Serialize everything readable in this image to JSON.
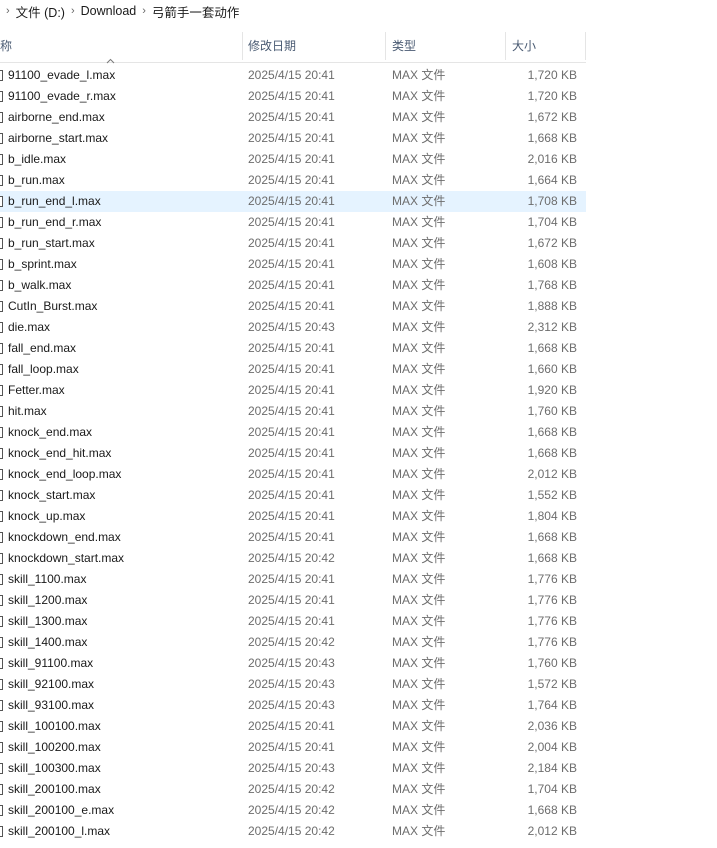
{
  "breadcrumb": {
    "items": [
      "文件 (D:)",
      "Download",
      "弓箭手一套动作"
    ],
    "separator": "›"
  },
  "columns": {
    "name": "称",
    "date": "修改日期",
    "type": "类型",
    "size": "大小"
  },
  "icons": {
    "sort": "sort-up-icon",
    "file": "file-icon",
    "separator": "chevron-right-icon"
  },
  "files": [
    {
      "name": "91100_evade_l.max",
      "date": "2025/4/15 20:41",
      "type": "MAX 文件",
      "size": "1,720 KB"
    },
    {
      "name": "91100_evade_r.max",
      "date": "2025/4/15 20:41",
      "type": "MAX 文件",
      "size": "1,720 KB"
    },
    {
      "name": "airborne_end.max",
      "date": "2025/4/15 20:41",
      "type": "MAX 文件",
      "size": "1,672 KB"
    },
    {
      "name": "airborne_start.max",
      "date": "2025/4/15 20:41",
      "type": "MAX 文件",
      "size": "1,668 KB"
    },
    {
      "name": "b_idle.max",
      "date": "2025/4/15 20:41",
      "type": "MAX 文件",
      "size": "2,016 KB"
    },
    {
      "name": "b_run.max",
      "date": "2025/4/15 20:41",
      "type": "MAX 文件",
      "size": "1,664 KB"
    },
    {
      "name": "b_run_end_l.max",
      "date": "2025/4/15 20:41",
      "type": "MAX 文件",
      "size": "1,708 KB"
    },
    {
      "name": "b_run_end_r.max",
      "date": "2025/4/15 20:41",
      "type": "MAX 文件",
      "size": "1,704 KB"
    },
    {
      "name": "b_run_start.max",
      "date": "2025/4/15 20:41",
      "type": "MAX 文件",
      "size": "1,672 KB"
    },
    {
      "name": "b_sprint.max",
      "date": "2025/4/15 20:41",
      "type": "MAX 文件",
      "size": "1,608 KB"
    },
    {
      "name": "b_walk.max",
      "date": "2025/4/15 20:41",
      "type": "MAX 文件",
      "size": "1,768 KB"
    },
    {
      "name": "CutIn_Burst.max",
      "date": "2025/4/15 20:41",
      "type": "MAX 文件",
      "size": "1,888 KB"
    },
    {
      "name": "die.max",
      "date": "2025/4/15 20:43",
      "type": "MAX 文件",
      "size": "2,312 KB"
    },
    {
      "name": "fall_end.max",
      "date": "2025/4/15 20:41",
      "type": "MAX 文件",
      "size": "1,668 KB"
    },
    {
      "name": "fall_loop.max",
      "date": "2025/4/15 20:41",
      "type": "MAX 文件",
      "size": "1,660 KB"
    },
    {
      "name": "Fetter.max",
      "date": "2025/4/15 20:41",
      "type": "MAX 文件",
      "size": "1,920 KB"
    },
    {
      "name": "hit.max",
      "date": "2025/4/15 20:41",
      "type": "MAX 文件",
      "size": "1,760 KB"
    },
    {
      "name": "knock_end.max",
      "date": "2025/4/15 20:41",
      "type": "MAX 文件",
      "size": "1,668 KB"
    },
    {
      "name": "knock_end_hit.max",
      "date": "2025/4/15 20:41",
      "type": "MAX 文件",
      "size": "1,668 KB"
    },
    {
      "name": "knock_end_loop.max",
      "date": "2025/4/15 20:41",
      "type": "MAX 文件",
      "size": "2,012 KB"
    },
    {
      "name": "knock_start.max",
      "date": "2025/4/15 20:41",
      "type": "MAX 文件",
      "size": "1,552 KB"
    },
    {
      "name": "knock_up.max",
      "date": "2025/4/15 20:41",
      "type": "MAX 文件",
      "size": "1,804 KB"
    },
    {
      "name": "knockdown_end.max",
      "date": "2025/4/15 20:41",
      "type": "MAX 文件",
      "size": "1,668 KB"
    },
    {
      "name": "knockdown_start.max",
      "date": "2025/4/15 20:42",
      "type": "MAX 文件",
      "size": "1,668 KB"
    },
    {
      "name": "skill_1100.max",
      "date": "2025/4/15 20:41",
      "type": "MAX 文件",
      "size": "1,776 KB"
    },
    {
      "name": "skill_1200.max",
      "date": "2025/4/15 20:41",
      "type": "MAX 文件",
      "size": "1,776 KB"
    },
    {
      "name": "skill_1300.max",
      "date": "2025/4/15 20:41",
      "type": "MAX 文件",
      "size": "1,776 KB"
    },
    {
      "name": "skill_1400.max",
      "date": "2025/4/15 20:42",
      "type": "MAX 文件",
      "size": "1,776 KB"
    },
    {
      "name": "skill_91100.max",
      "date": "2025/4/15 20:43",
      "type": "MAX 文件",
      "size": "1,760 KB"
    },
    {
      "name": "skill_92100.max",
      "date": "2025/4/15 20:43",
      "type": "MAX 文件",
      "size": "1,572 KB"
    },
    {
      "name": "skill_93100.max",
      "date": "2025/4/15 20:43",
      "type": "MAX 文件",
      "size": "1,764 KB"
    },
    {
      "name": "skill_100100.max",
      "date": "2025/4/15 20:41",
      "type": "MAX 文件",
      "size": "2,036 KB"
    },
    {
      "name": "skill_100200.max",
      "date": "2025/4/15 20:41",
      "type": "MAX 文件",
      "size": "2,004 KB"
    },
    {
      "name": "skill_100300.max",
      "date": "2025/4/15 20:43",
      "type": "MAX 文件",
      "size": "2,184 KB"
    },
    {
      "name": "skill_200100.max",
      "date": "2025/4/15 20:42",
      "type": "MAX 文件",
      "size": "1,704 KB"
    },
    {
      "name": "skill_200100_e.max",
      "date": "2025/4/15 20:42",
      "type": "MAX 文件",
      "size": "1,668 KB"
    },
    {
      "name": "skill_200100_l.max",
      "date": "2025/4/15 20:42",
      "type": "MAX 文件",
      "size": "2,012 KB"
    }
  ],
  "selected_file": "b_run_end_l.max",
  "colors": {
    "selected_row": "#cce8ff",
    "header_text": "#4a5b73",
    "dim_text": "#6d6d6d"
  }
}
